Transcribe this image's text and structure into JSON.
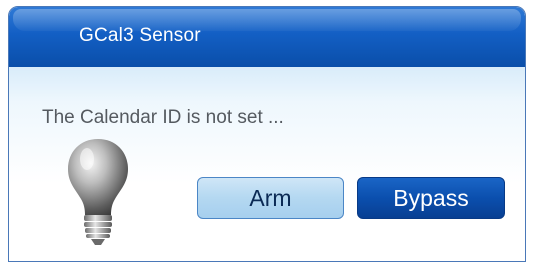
{
  "widget": {
    "title": "GCal3 Sensor",
    "message": "The Calendar ID is not set ...",
    "status_icon": "lightbulb-off-icon"
  },
  "buttons": {
    "arm_label": "Arm",
    "bypass_label": "Bypass"
  },
  "colors": {
    "titlebar": "#135fc4",
    "arm_button": "#b4d8f1",
    "bypass_button": "#0b4fae"
  }
}
